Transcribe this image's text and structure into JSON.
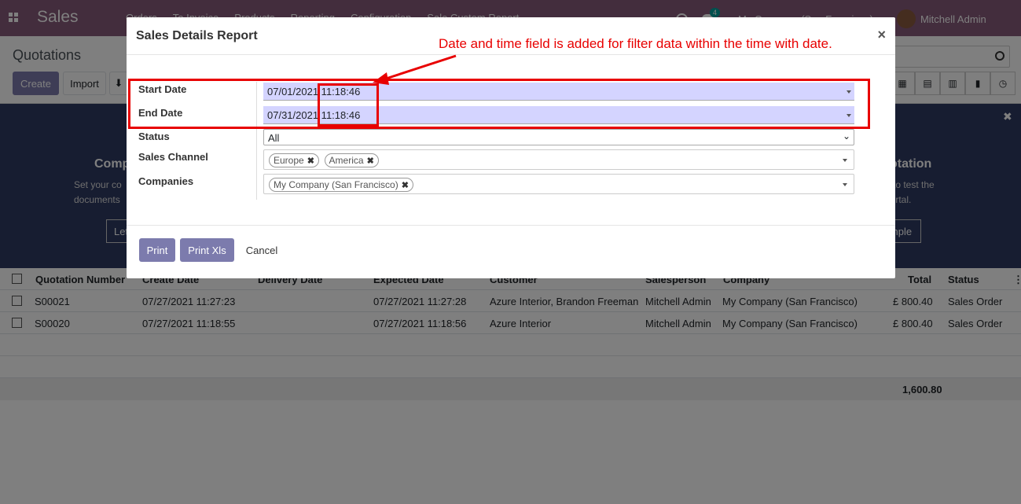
{
  "topbar": {
    "app_title": "Sales",
    "menu": [
      "Orders",
      "To Invoice",
      "Products",
      "Reporting",
      "Configuration",
      "Sale Custom Report"
    ],
    "badge_count": "4",
    "company": "My Company (San Francisco)",
    "user": "Mitchell Admin"
  },
  "control": {
    "breadcrumb": "Quotations",
    "create_label": "Create",
    "import_label": "Import"
  },
  "helper": {
    "left_title": "Comp",
    "left_line1": "Set your co",
    "left_line2": "documents",
    "left_button": "Let",
    "right_title": "otation",
    "right_line1": "n to test the",
    "right_line2": "portal.",
    "right_button": "mple"
  },
  "table": {
    "headers": [
      "Quotation Number",
      "Create Date",
      "Delivery Date",
      "Expected Date",
      "Customer",
      "Salesperson",
      "Company",
      "Total",
      "Status"
    ],
    "rows": [
      {
        "number": "S00021",
        "create": "07/27/2021 11:27:23",
        "delivery": "",
        "expected": "07/27/2021 11:27:28",
        "customer": "Azure Interior, Brandon Freeman",
        "salesperson": "Mitchell Admin",
        "company": "My Company (San Francisco)",
        "total": "£ 800.40",
        "status": "Sales Order"
      },
      {
        "number": "S00020",
        "create": "07/27/2021 11:18:55",
        "delivery": "",
        "expected": "07/27/2021 11:18:56",
        "customer": "Azure Interior",
        "salesperson": "Mitchell Admin",
        "company": "My Company (San Francisco)",
        "total": "£ 800.40",
        "status": "Sales Order"
      }
    ],
    "footer_total": "1,600.80"
  },
  "modal": {
    "title": "Sales Details Report",
    "close": "×",
    "start_date_label": "Start Date",
    "start_date_value": "07/01/2021 11:18:46",
    "end_date_label": "End Date",
    "end_date_value": "07/31/2021 11:18:46",
    "status_label": "Status",
    "status_value": "All",
    "sales_channel_label": "Sales Channel",
    "sales_channels": [
      "Europe",
      "America"
    ],
    "companies_label": "Companies",
    "companies": [
      "My Company (San Francisco)"
    ],
    "print_label": "Print",
    "print_xls_label": "Print Xls",
    "cancel_label": "Cancel"
  },
  "annotation": {
    "text": "Date and time field is added for filter data within the time with date."
  },
  "colors": {
    "brand": "#875A7B",
    "primary_button": "#7C7BAD",
    "date_field_bg": "#d4d4ff",
    "annotation": "#e80000"
  }
}
